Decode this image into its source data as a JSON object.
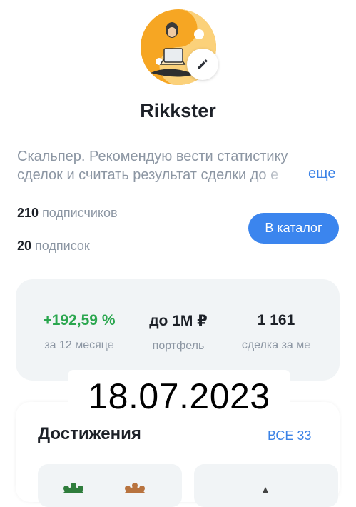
{
  "profile": {
    "name": "Rikkster",
    "bio": "Скальпер. Рекомендую вести статистику сделок и считать результат сделки до е",
    "more_label": "еще",
    "followers_count": "210",
    "followers_label": "подписчиков",
    "following_count": "20",
    "following_label": "подписок",
    "catalog_button": "В каталог"
  },
  "stats": [
    {
      "value": "+192,59 %",
      "label": "за 12 месяце",
      "color": "#2aa64e"
    },
    {
      "value": "до 1М ₽",
      "label": "портфель",
      "color": "#1d2128"
    },
    {
      "value": "1 161",
      "label": "сделка за ме",
      "color": "#1d2128"
    }
  ],
  "achievements": {
    "title": "Достижения",
    "all_label": "ВСЕ 33"
  },
  "overlay_date": "18.07.2023",
  "icons": {
    "edit": "pencil-icon",
    "avatar": "avatar-illustration"
  },
  "colors": {
    "accent": "#3b85ee",
    "positive": "#2aa64e",
    "avatar_orange": "#f5a623"
  }
}
